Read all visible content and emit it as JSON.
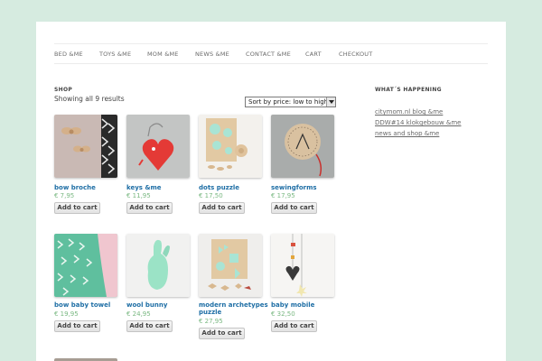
{
  "nav": {
    "items": [
      "BED &ME",
      "TOYS &ME",
      "MOM &ME",
      "NEWS &ME",
      "CONTACT &ME",
      "CART",
      "CHECKOUT"
    ]
  },
  "shop": {
    "heading": "SHOP",
    "results_text": "Showing all 9 results",
    "sort_selected": "Sort by price: low to high"
  },
  "products": [
    {
      "name": "bow broche",
      "price": "€ 7,95",
      "button": "Add to cart",
      "image": "bow-brooch-photo"
    },
    {
      "name": "keys &me",
      "price": "€ 11,95",
      "button": "Add to cart",
      "image": "heart-keychain-photo"
    },
    {
      "name": "dots puzzle",
      "price": "€ 17,50",
      "button": "Add to cart",
      "image": "dots-puzzle-photo"
    },
    {
      "name": "sewingforms",
      "price": "€ 17,95",
      "button": "Add to cart",
      "image": "sewing-form-photo"
    },
    {
      "name": "bow baby towel",
      "price": "€ 19,95",
      "button": "Add to cart",
      "image": "baby-towel-photo"
    },
    {
      "name": "wool bunny",
      "price": "€ 24,95",
      "button": "Add to cart",
      "image": "wool-bunny-photo"
    },
    {
      "name": "modern archetypes puzzle",
      "price": "€ 27,95",
      "button": "Add to cart",
      "image": "archetypes-puzzle-photo"
    },
    {
      "name": "baby mobile",
      "price": "€ 32,50",
      "button": "Add to cart",
      "image": "baby-mobile-photo"
    }
  ],
  "sidebar": {
    "title": "WHAT´S HAPPENING",
    "links": [
      "citymom.nl blog &me",
      "DDW#14 klokgebouw &me",
      "news and shop &me"
    ]
  },
  "colors": {
    "background": "#d6ebe0",
    "link": "#1e6ea5",
    "price": "#7ab882"
  }
}
